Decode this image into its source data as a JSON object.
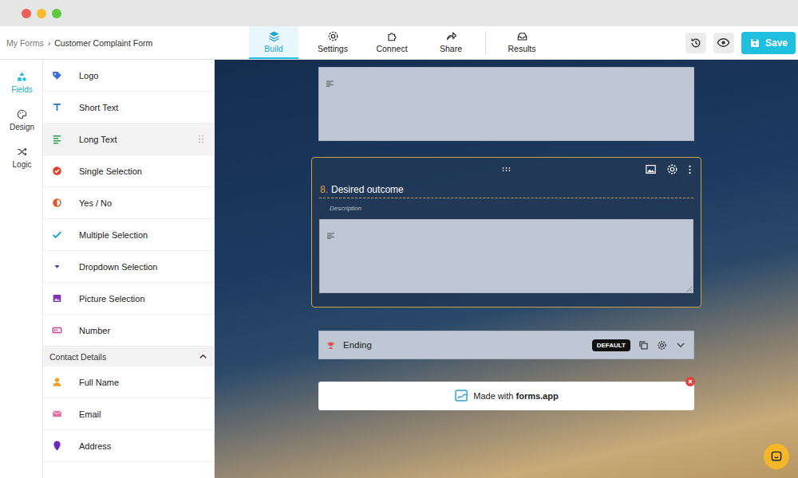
{
  "window": {
    "controls": [
      "close",
      "minimize",
      "zoom"
    ]
  },
  "breadcrumb": {
    "items": [
      "My Forms",
      "Customer Complaint Form"
    ],
    "separator": "›"
  },
  "tabs": [
    {
      "label": "Build",
      "selected": true
    },
    {
      "label": "Settings",
      "selected": false
    },
    {
      "label": "Connect",
      "selected": false
    },
    {
      "label": "Share",
      "selected": false
    },
    {
      "label": "Results",
      "selected": false
    }
  ],
  "save_button": {
    "label": "Save"
  },
  "rail": [
    {
      "label": "Fields",
      "selected": true
    },
    {
      "label": "Design",
      "selected": false
    },
    {
      "label": "Logic",
      "selected": false
    }
  ],
  "fields": [
    {
      "label": "Logo",
      "hovered": false,
      "color": "#3b6fd8"
    },
    {
      "label": "Short Text",
      "hovered": false,
      "color": "#2a7ac0"
    },
    {
      "label": "Long Text",
      "hovered": true,
      "color": "#2e9e4f"
    },
    {
      "label": "Single Selection",
      "hovered": false,
      "color": "#e0402a"
    },
    {
      "label": "Yes / No",
      "hovered": false,
      "color": "#e0582a"
    },
    {
      "label": "Multiple Selection",
      "hovered": false,
      "color": "#1aa0d8"
    },
    {
      "label": "Dropdown Selection",
      "hovered": false,
      "color": "#3a3ab0"
    },
    {
      "label": "Picture Selection",
      "hovered": false,
      "color": "#7a3ab0"
    },
    {
      "label": "Number",
      "hovered": false,
      "color": "#d04090"
    }
  ],
  "section": {
    "title": "Contact Details",
    "expanded": true,
    "items": [
      {
        "label": "Full Name",
        "color": "#f0a020"
      },
      {
        "label": "Email",
        "color": "#e070a0"
      },
      {
        "label": "Address",
        "color": "#6a2ac0"
      }
    ]
  },
  "question": {
    "number": "8.",
    "title": "Desired outcome",
    "description": "Description",
    "selected": true
  },
  "ending": {
    "label": "Ending",
    "badge": "DEFAULT",
    "expanded": false
  },
  "branding": {
    "prefix": "Made with",
    "brand": "forms.app"
  }
}
